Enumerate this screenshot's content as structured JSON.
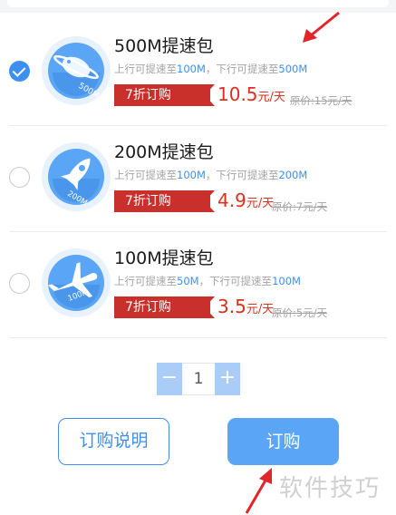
{
  "packages": [
    {
      "title": "500M提速包",
      "desc_prefix": "上行可提速至",
      "up_speed": "100M",
      "desc_mid": "，下行可提速至",
      "down_speed": "500M",
      "discount": "7折订购",
      "price": "10.5",
      "price_unit": "元/天",
      "original_price": "原价:15元/天",
      "selected": true,
      "icon": "ufo-planet-icon",
      "icon_label": "500M"
    },
    {
      "title": "200M提速包",
      "desc_prefix": "上行可提速至",
      "up_speed": "100M",
      "desc_mid": "，下行可提速至",
      "down_speed": "200M",
      "discount": "7折订购",
      "price": "4.9",
      "price_unit": "元/天",
      "original_price": "原价:7元/天",
      "selected": false,
      "icon": "rocket-icon",
      "icon_label": "200M"
    },
    {
      "title": "100M提速包",
      "desc_prefix": "上行可提速至",
      "up_speed": "50M",
      "desc_mid": "，下行可提速至",
      "down_speed": "100M",
      "discount": "7折订购",
      "price": "3.5",
      "price_unit": "元/天",
      "original_price": "原价:5元/天",
      "selected": false,
      "icon": "airplane-icon",
      "icon_label": "100M"
    }
  ],
  "stepper": {
    "minus": "−",
    "value": "1",
    "plus": "+"
  },
  "buttons": {
    "info": "订购说明",
    "order": "订购"
  },
  "watermark": "软件技巧",
  "colors": {
    "accent": "#3d8ff2",
    "price": "#d9301f",
    "discount_tag": "#c9302c",
    "annotation_arrow": "#e0262a"
  }
}
